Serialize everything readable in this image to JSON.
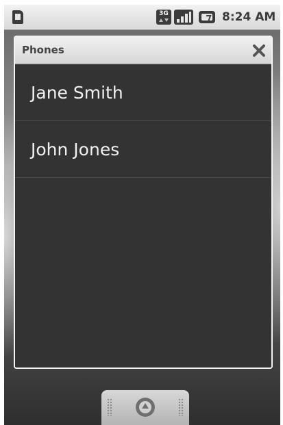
{
  "status_bar": {
    "network_label": "3G",
    "time": "8:24 AM",
    "icons": [
      "sim-card-icon",
      "3g-data-icon",
      "signal-strength-icon",
      "battery-charging-icon"
    ]
  },
  "dialog": {
    "title": "Phones",
    "close_icon": "close-icon",
    "items": [
      {
        "label": "Jane Smith"
      },
      {
        "label": "John Jones"
      }
    ]
  },
  "dock": {
    "icon": "app-drawer-icon"
  },
  "colors": {
    "dialog_background": "#333333",
    "dialog_header": "#e3e3e3",
    "item_text": "#f0f0f0"
  }
}
